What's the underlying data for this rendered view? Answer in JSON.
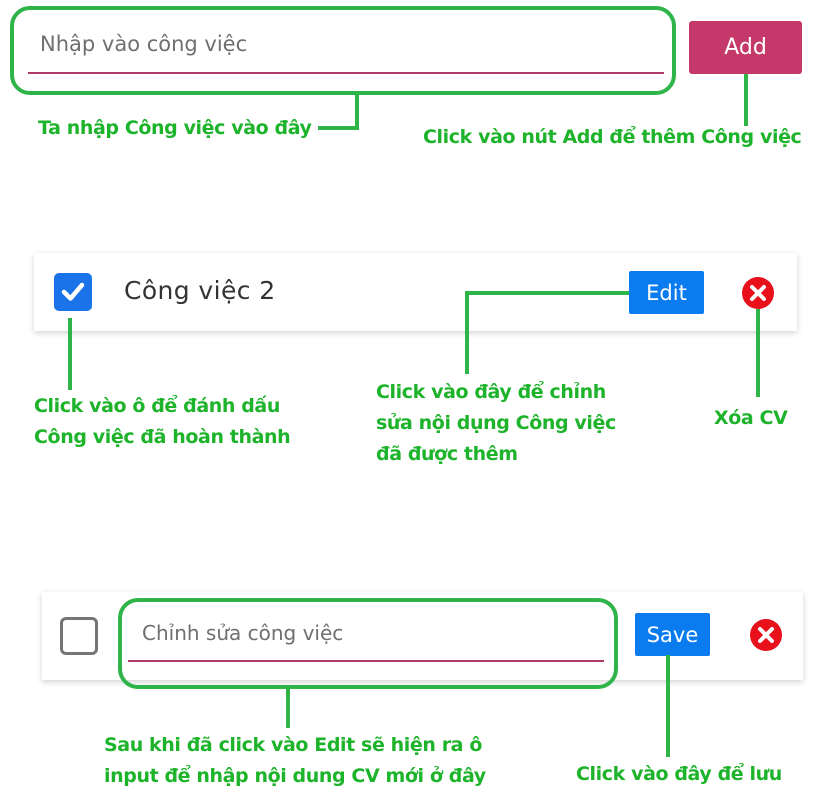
{
  "add_form": {
    "input_placeholder": "Nhập vào công việc",
    "add_label": "Add"
  },
  "todo_item": {
    "text": "Công việc 2",
    "checked": true,
    "edit_label": "Edit",
    "delete_icon": "close-circle-icon"
  },
  "edit_item": {
    "checked": false,
    "input_placeholder": "Chỉnh sửa công việc",
    "save_label": "Save",
    "delete_icon": "close-circle-icon"
  },
  "annotations": {
    "input_note": "Ta nhập Công việc vào đây",
    "add_note": "Click vào nút Add để thêm Công việc",
    "checkbox_note": [
      "Click vào ô để đánh dấu",
      "Công việc đã hoàn thành"
    ],
    "edit_note": [
      "Click vào đây để chỉnh",
      "sửa nội dụng Công việc",
      "đã được thêm"
    ],
    "delete_note": "Xóa CV",
    "edit_input_note": [
      "Sau khi đã click vào Edit sẽ hiện ra ô",
      "input để nhập nội dung CV mới ở đây"
    ],
    "save_note": "Click vào đây để lưu"
  },
  "colors": {
    "annotation_green": "#2fb44a",
    "add_button": "#c4386a",
    "blue_button": "#0a7cf0",
    "delete_red": "#e8101b"
  }
}
